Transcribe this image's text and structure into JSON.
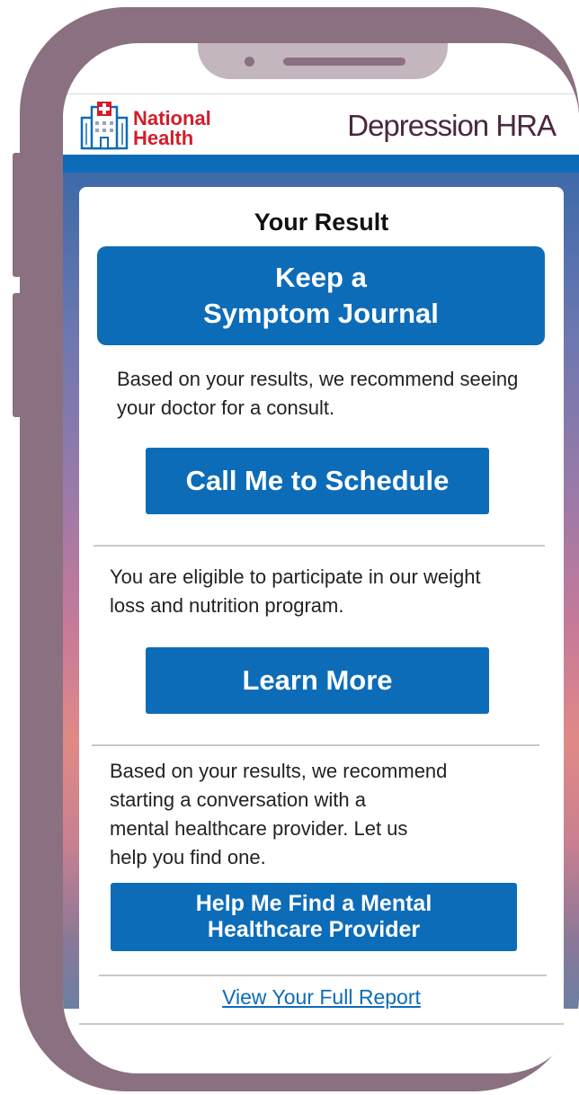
{
  "header": {
    "logo_line1": "National",
    "logo_line2": "Health",
    "app_title_bold": "Depression",
    "app_title_light": " HRA"
  },
  "card": {
    "title": "Your Result",
    "recommendation_line1": "Keep a",
    "recommendation_line2": "Symptom Journal",
    "doctor_text": "Based on your results, we recommend seeing your doctor for a consult.",
    "schedule_button": "Call Me to Schedule",
    "program_text": "You are eligible to participate in our weight loss and nutrition program.",
    "learn_more_button": "Learn More",
    "mental_text_1": "Based on your results, we recommend",
    "mental_text_2": "starting a conversation with a",
    "mental_text_3": "mental healthcare provider. Let us",
    "mental_text_4": "help you find one.",
    "provider_button_line1": "Help Me Find a Mental",
    "provider_button_line2": "Healthcare Provider",
    "report_link": "View Your Full Report"
  },
  "colors": {
    "brand_blue": "#0d6cb8",
    "brand_red": "#d11e2a",
    "title_purple": "#4a2840",
    "phone_frame": "#8a7080"
  },
  "icons": {
    "logo": "hospital-icon"
  }
}
